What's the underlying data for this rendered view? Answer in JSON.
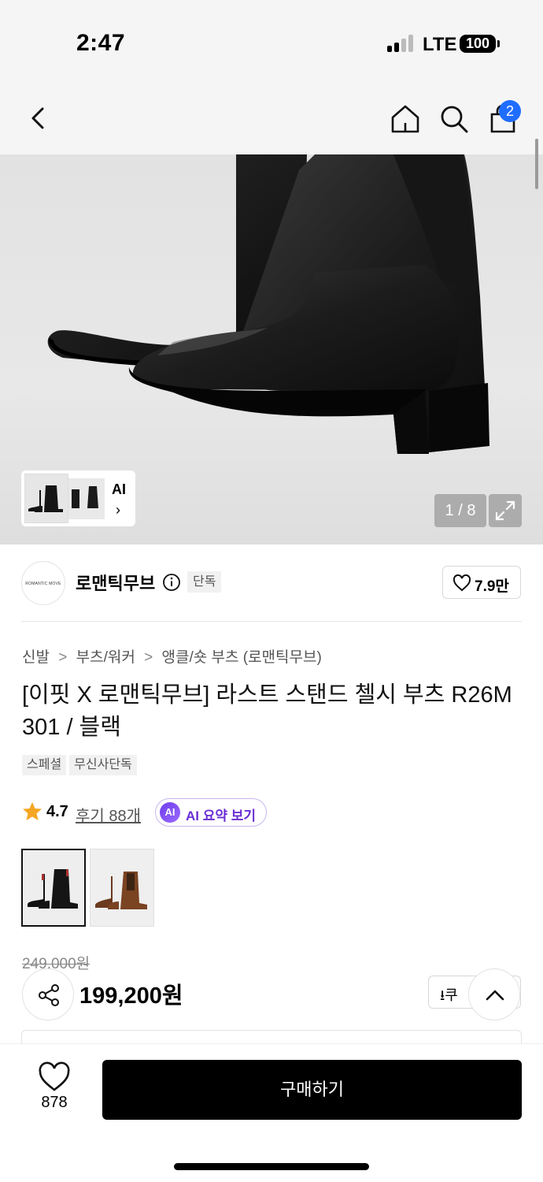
{
  "status_bar": {
    "time": "2:47",
    "network": "LTE",
    "battery": "100"
  },
  "nav": {
    "cart_count": "2"
  },
  "gallery": {
    "counter": "1 / 8",
    "thumb_label": "AI",
    "thumb_chevron": "›"
  },
  "brand": {
    "logo_text": "ROMANTIC MOVE",
    "name": "로맨틱무브",
    "tag": "단독",
    "likes": "7.9만"
  },
  "breadcrumb": [
    "신발",
    "부츠/워커",
    "앵클/숏 부츠 (로맨틱무브)"
  ],
  "breadcrumb_sep": ">",
  "product": {
    "title": "[이핏 X 로맨틱무브] 라스트 스탠드 첼시 부츠 R26M 301 / 블랙",
    "tags": [
      "스페셜",
      "무신사단독"
    ],
    "rating": "4.7",
    "reviews": "후기 88개",
    "ai_summary": "AI 요약 보기",
    "ai_badge": "AI",
    "original_price": "249,000원",
    "price": "199,200원",
    "coupon_label": "⭳쿠"
  },
  "bottom": {
    "wish_count": "878",
    "buy_label": "구매하기"
  },
  "colors": {
    "accent_blue": "#1f6dff",
    "ai_purple": "#6a2fd4"
  }
}
